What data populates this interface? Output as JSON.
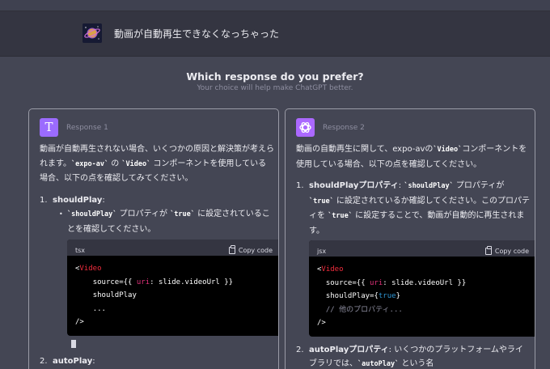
{
  "user": {
    "message": "動画が自動再生できなくなっちゃった",
    "avatar": "planet-avatar-icon"
  },
  "prompt": {
    "title": "Which response do you prefer?",
    "subtitle": "Your choice will help make ChatGPT better."
  },
  "responses": [
    {
      "label": "Response 1",
      "badge_letter": "T",
      "badge_color": "#9b6bff",
      "intro_a": "動画が自動再生されない場合、いくつかの原因と解決策が考えられます。",
      "intro_code1": "`expo-av`",
      "intro_b": " の ",
      "intro_code2": "`Video`",
      "intro_c": " コンポーネントを使用している場合、以下の点を確認してみてください。",
      "item1_num": "1.",
      "item1_title": "shouldPlay",
      "item1_colon": ":",
      "sub1_code1": "`shouldPlay`",
      "sub1_text1": " プロパティが ",
      "sub1_code2": "`true`",
      "sub1_text2": " に設定されていることを確認してください。",
      "code_lang": "tsx",
      "copy_label": "Copy code",
      "code_lines": {
        "l1_open": "<",
        "l1_tag": "Video",
        "l2_prop": "source={{ ",
        "l2_key": "uri",
        "l2_rest": ": slide.videoUrl }}",
        "l3": "shouldPlay",
        "l4": "...",
        "l5": "/>"
      },
      "item2_num": "2.",
      "item2_title": "autoPlay",
      "item2_colon": ":"
    },
    {
      "label": "Response 2",
      "badge_color": "#ab68ff",
      "badge_icon": "openai-logo-icon",
      "intro_a": "動画の自動再生に関して、expo-avの",
      "intro_code1": "`Video`",
      "intro_b": "コンポーネントを使用している場合、以下の点を確認してください。",
      "item1_num": "1.",
      "item1_title": "shouldPlayプロパティ",
      "item1_colon": ": ",
      "item1_code1": "`shouldPlay`",
      "item1_text1": " プロパティが ",
      "item1_code2": "`true`",
      "item1_text2": " に設定されているか確認してください。このプロパティを ",
      "item1_code3": "`true`",
      "item1_text3": " に設定することで、動画が自動的に再生されます。",
      "code_lang": "jsx",
      "copy_label": "Copy code",
      "code_lines": {
        "l1_open": "<",
        "l1_tag": "Video",
        "l2_prop": "source={{ ",
        "l2_key": "uri",
        "l2_rest": ": slide.videoUrl }}",
        "l3_prop": "shouldPlay={",
        "l3_val": "true",
        "l3_close": "}",
        "l4": "// 他のプロパティ...",
        "l5": "/>"
      },
      "item2_num": "2.",
      "item2_title": "autoPlayプロパティ",
      "item2_colon": ": ",
      "item2_text1": "いくつかのプラットフォームやライブラリでは、",
      "item2_code1": "`autoPlay`",
      "item2_text2": " という名"
    }
  ]
}
